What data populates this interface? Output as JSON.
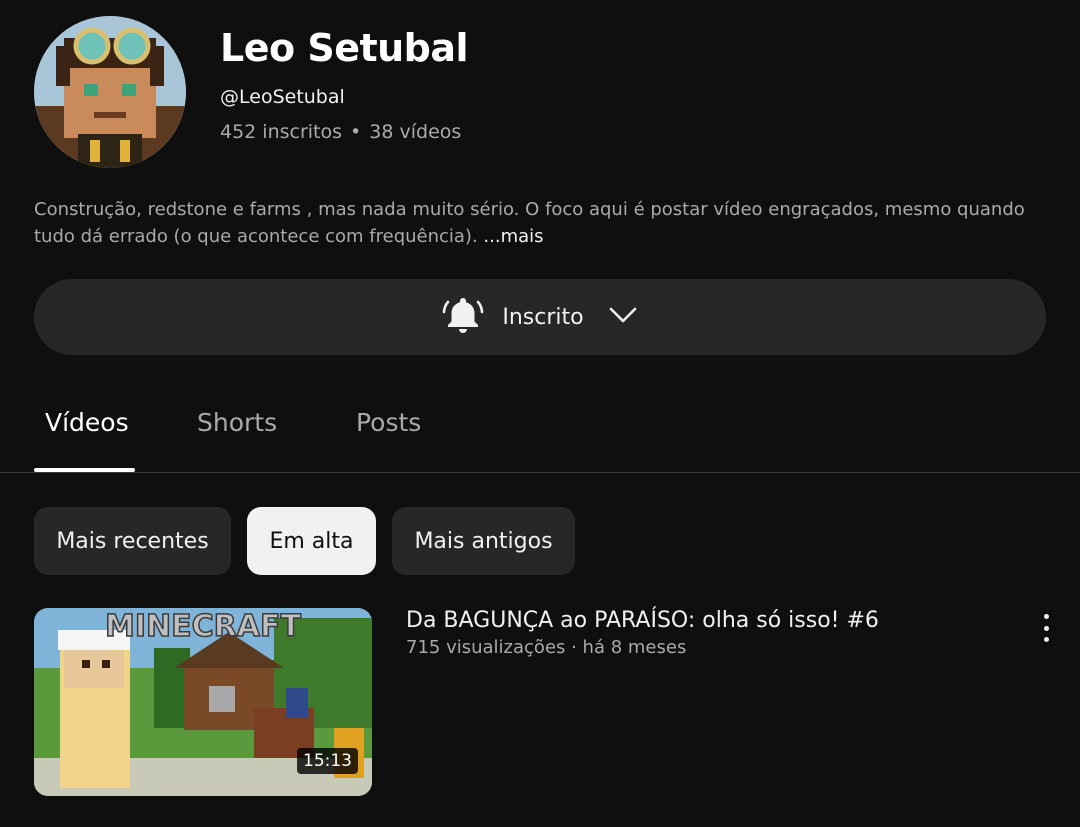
{
  "channel": {
    "name": "Leo Setubal",
    "handle": "@LeoSetubal",
    "subscribers": "452 inscritos",
    "separator": "•",
    "videos": "38 vídeos",
    "description": "Construção, redstone e farms , mas nada muito sério. O foco aqui é postar vídeo engraçados, mesmo quando tudo dá errado (o que acontece com frequência).",
    "more_label": "...mais"
  },
  "subscribe": {
    "label": "Inscrito",
    "bell_icon": "bell-icon",
    "chevron_icon": "chevron-down-icon"
  },
  "tabs": [
    {
      "label": "Vídeos",
      "active": true
    },
    {
      "label": "Shorts",
      "active": false
    },
    {
      "label": "Posts",
      "active": false
    }
  ],
  "chips": [
    {
      "label": "Mais recentes",
      "active": false
    },
    {
      "label": "Em alta",
      "active": true
    },
    {
      "label": "Mais antigos",
      "active": false
    }
  ],
  "videos": [
    {
      "title": "Da BAGUNÇA ao PARAÍSO: olha só isso! #6",
      "meta": "715 visualizações · há 8 meses",
      "duration": "15:13",
      "thumbnail_text": "MINECRAFT"
    }
  ],
  "colors": {
    "background": "#0f0f0f",
    "surface": "#272727",
    "text_primary": "#f1f1f1",
    "text_secondary": "#aaaaaa"
  }
}
